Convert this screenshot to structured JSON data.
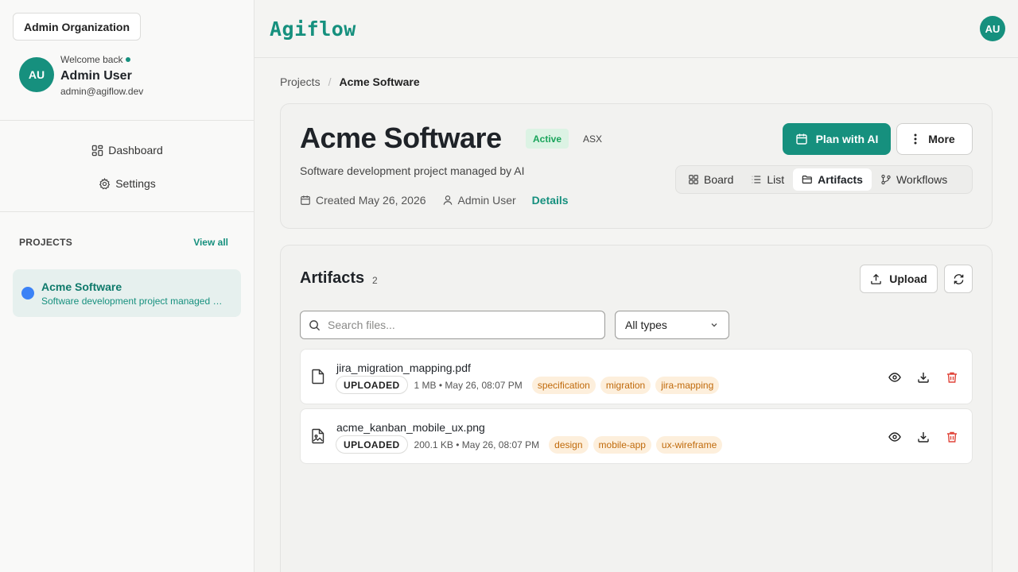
{
  "sidebar": {
    "org_label": "Admin Organization",
    "welcome": "Welcome back",
    "avatar_initials": "AU",
    "user_name": "Admin User",
    "user_email": "admin@agiflow.dev",
    "nav": [
      {
        "label": "Dashboard",
        "icon": "dashboard-icon"
      },
      {
        "label": "Settings",
        "icon": "gear-icon"
      }
    ],
    "projects_title": "PROJECTS",
    "view_all": "View all",
    "projects": [
      {
        "name": "Acme Software",
        "description": "Software development project managed by AI",
        "color": "#3b82f6"
      }
    ]
  },
  "topbar": {
    "logo": "Agiflow",
    "avatar_initials": "AU"
  },
  "breadcrumb": {
    "parent": "Projects",
    "current": "Acme Software"
  },
  "project": {
    "title": "Acme Software",
    "status": "Active",
    "key": "ASX",
    "description": "Software development project managed by AI",
    "created": "Created May 26, 2026",
    "owner": "Admin User",
    "details_link": "Details",
    "plan_button": "Plan with AI",
    "more_button": "More",
    "view_tabs": [
      {
        "label": "Board",
        "icon": "grid-icon",
        "active": false
      },
      {
        "label": "List",
        "icon": "list-icon",
        "active": false
      },
      {
        "label": "Artifacts",
        "icon": "folder-icon",
        "active": true
      },
      {
        "label": "Workflows",
        "icon": "workflow-icon",
        "active": false
      }
    ]
  },
  "artifacts": {
    "title": "Artifacts",
    "count": "2",
    "upload_button": "Upload",
    "search_placeholder": "Search files...",
    "type_filter": "All types",
    "files": [
      {
        "name": "jira_migration_mapping.pdf",
        "status": "UPLOADED",
        "info": "1 MB • May 26, 08:07 PM",
        "tags": [
          "specification",
          "migration",
          "jira-mapping"
        ],
        "icon": "file-icon"
      },
      {
        "name": "acme_kanban_mobile_ux.png",
        "status": "UPLOADED",
        "info": "200.1 KB • May 26, 08:07 PM",
        "tags": [
          "design",
          "mobile-app",
          "ux-wireframe"
        ],
        "icon": "image-file-icon"
      }
    ]
  },
  "colors": {
    "accent": "#16907e",
    "tag_bg": "#fdefdc",
    "tag_text": "#c06a0b",
    "delete": "#e0453a"
  }
}
